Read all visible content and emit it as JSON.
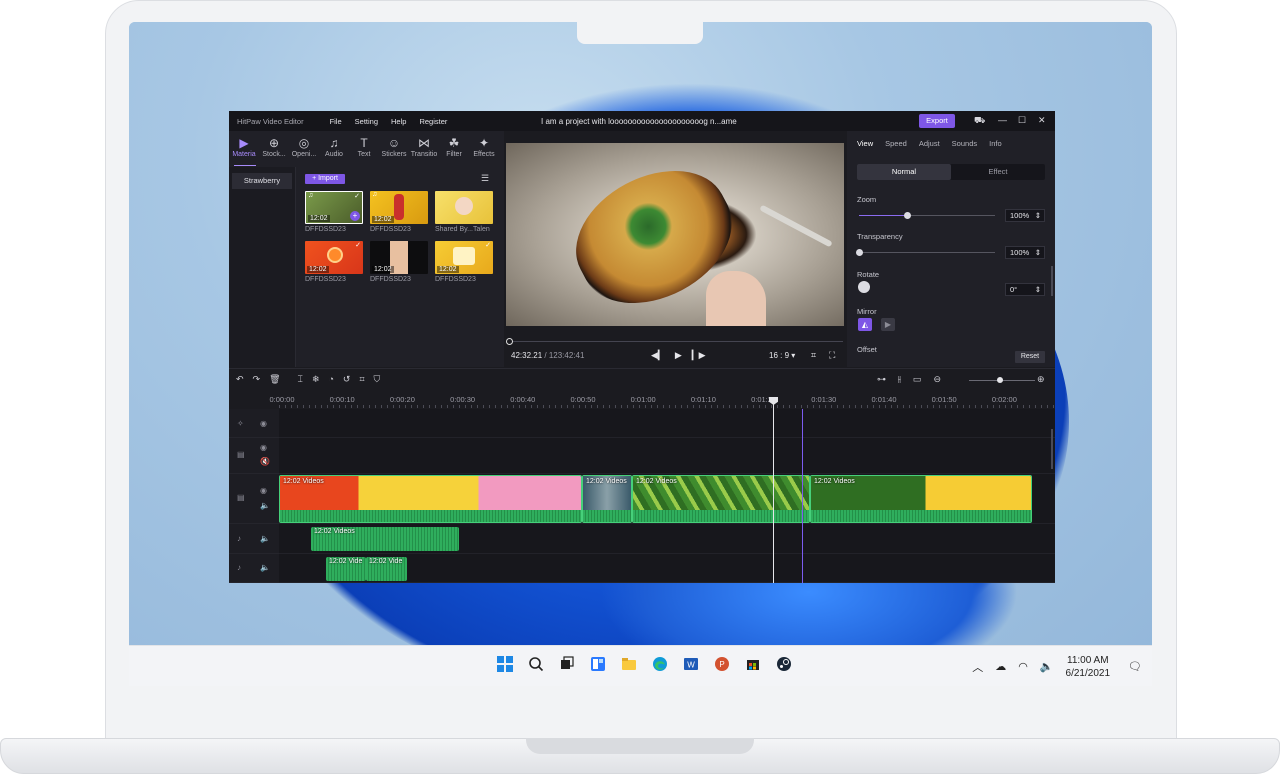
{
  "app": {
    "brand": "HitPaw Video Editor",
    "menu": [
      "File",
      "Setting",
      "Help",
      "Register"
    ],
    "project_title": "I am a project with looooooooooooooooooooog n...ame",
    "export_label": "Export"
  },
  "tools": [
    {
      "label": "Materia",
      "icon": "▶"
    },
    {
      "label": "Stock...",
      "icon": "⊕"
    },
    {
      "label": "Openi...",
      "icon": "◎"
    },
    {
      "label": "Audio",
      "icon": "♫"
    },
    {
      "label": "Text",
      "icon": "T"
    },
    {
      "label": "Stickers",
      "icon": "☺"
    },
    {
      "label": "Transitio",
      "icon": "⋈"
    },
    {
      "label": "Filter",
      "icon": "☘"
    },
    {
      "label": "Effects",
      "icon": "✦"
    }
  ],
  "folder": {
    "name": "Strawberry"
  },
  "import_label": "+ Import",
  "media": [
    {
      "label": "DFFDSSD23",
      "duration": "12:02",
      "color": "#6a8a3a"
    },
    {
      "label": "DFFDSSD23",
      "duration": "12:02",
      "color": "#e6b21c"
    },
    {
      "label": "Shared By...Talen",
      "duration": "",
      "color": "#f2d24a"
    },
    {
      "label": "DFFDSSD23",
      "duration": "12:02",
      "color": "#e8461e"
    },
    {
      "label": "DFFDSSD23",
      "duration": "12:02",
      "color": "#3a1c1c"
    },
    {
      "label": "DFFDSSD23",
      "duration": "12:02",
      "color": "#f0c02a"
    }
  ],
  "preview": {
    "current_time": "42:32.21",
    "total_time": "/ 123:42:41",
    "ratio": "16 : 9 ▾"
  },
  "right_panel": {
    "tabs": [
      "View",
      "Speed",
      "Adjust",
      "Sounds",
      "Info"
    ],
    "segment": [
      "Normal",
      "Effect"
    ],
    "zoom_label": "Zoom",
    "zoom_value": "100%",
    "zoom_level": 0.35,
    "transparency_label": "Transparency",
    "transparency_value": "100%",
    "transparency_level": 0.0,
    "rotate_label": "Rotate",
    "rotate_value": "0°",
    "mirror_label": "Mirror",
    "offset_label": "Offset",
    "reset_label": "Reset"
  },
  "ruler": [
    "0:00:00",
    "0:00:10",
    "0:00:20",
    "0:00:30",
    "0:00:40",
    "0:00:50",
    "0:01:00",
    "0:01:10",
    "0:01:20",
    "0:01:30",
    "0:01:40",
    "0:01:50",
    "0:02:00"
  ],
  "clips": {
    "main": [
      "12:02  Videos",
      "12:02  Videos",
      "12:02  Videos",
      "12:02  Videos"
    ],
    "audio1": "12:02  Videos",
    "audio2a": "12:02  Vide",
    "audio2b": "12:02  Vide"
  },
  "taskbar": {
    "time": "11:00 AM",
    "date": "6/21/2021"
  }
}
